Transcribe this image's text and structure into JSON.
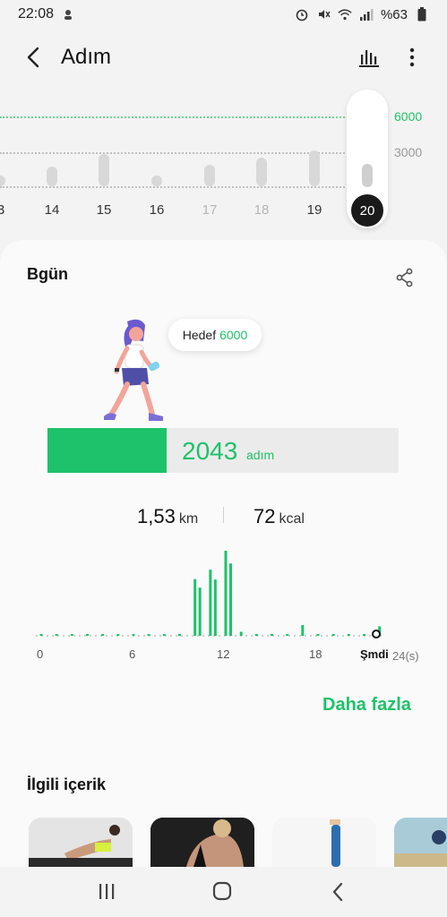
{
  "status": {
    "time": "22:08",
    "battery": "%63"
  },
  "header": {
    "title": "Adım"
  },
  "weekly": {
    "goal_label": "6000",
    "mid_label": "3000",
    "days": [
      {
        "label": "3",
        "muted": false
      },
      {
        "label": "14",
        "muted": false
      },
      {
        "label": "15",
        "muted": false
      },
      {
        "label": "16",
        "muted": false
      },
      {
        "label": "17",
        "muted": true
      },
      {
        "label": "18",
        "muted": true
      },
      {
        "label": "19",
        "muted": false
      }
    ],
    "selected_day": "20"
  },
  "card": {
    "title": "Bgün",
    "goal_prefix": "Hedef",
    "goal_value": "6000",
    "steps": "2043",
    "steps_unit": "adım",
    "progress_fraction": 0.34,
    "distance": "1,53",
    "distance_unit": "km",
    "calories": "72",
    "calories_unit": "kcal",
    "hourly_ticks": [
      "0",
      "6",
      "12",
      "18"
    ],
    "now_label": "Şmdi",
    "hour_unit": "24(s)",
    "more_link": "Daha fazla"
  },
  "related": {
    "title": "İlgili içerik"
  },
  "colors": {
    "accent": "#1ec26a",
    "selected_bg": "#1a1a1a"
  },
  "chart_data": {
    "type": "bar",
    "title": "",
    "xlabel": "",
    "ylabel": "",
    "x_ticks": [
      "0",
      "6",
      "12",
      "18"
    ],
    "hours": [
      0,
      1,
      2,
      3,
      4,
      5,
      6,
      7,
      8,
      9,
      10,
      11,
      12,
      13,
      14,
      15,
      16,
      17,
      18,
      19,
      20,
      21,
      22,
      23
    ],
    "values": [
      5,
      2,
      2,
      2,
      3,
      3,
      5,
      4,
      8,
      10,
      420,
      490,
      630,
      30,
      6,
      3,
      6,
      80,
      6,
      5,
      4,
      6,
      70,
      0
    ],
    "grid": false,
    "legend": "none"
  }
}
